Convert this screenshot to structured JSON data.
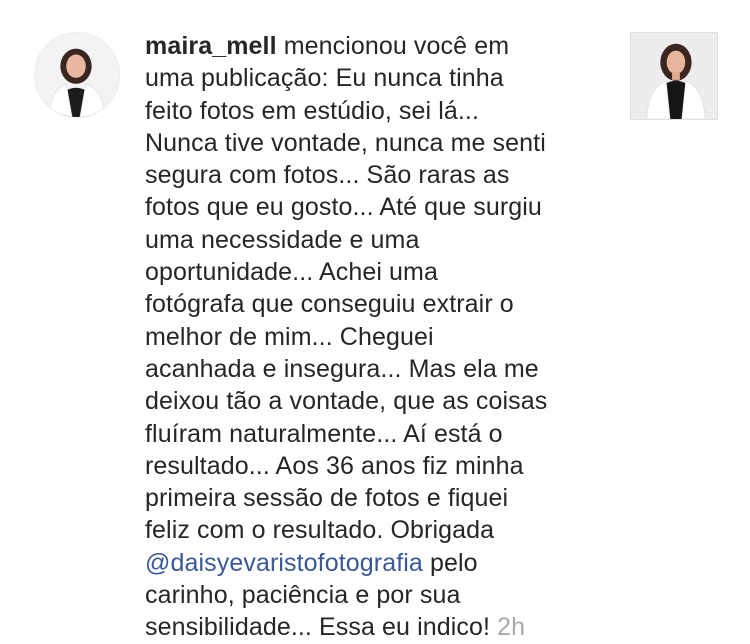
{
  "notification": {
    "username": "maira_mell",
    "lines": [
      "mencionou você em",
      "uma publicação: Eu nunca tinha",
      "feito fotos em estúdio, sei lá...",
      "Nunca tive vontade, nunca me senti",
      "segura com fotos... São raras as",
      "fotos que eu gosto... Até que surgiu",
      "uma necessidade e uma",
      "oportunidade... Achei uma",
      "fotógrafa que conseguiu extrair o",
      "melhor de mim... Cheguei",
      "acanhada e insegura... Mas ela me",
      "deixou tão a vontade, que as coisas",
      "fluíram naturalmente... Aí está o",
      "resultado... Aos 36 anos fiz minha",
      "primeira sessão de fotos e fiquei",
      "feliz com o resultado. Obrigada"
    ],
    "mention": "@daisyevaristofotografia",
    "after_mention": "pelo",
    "line_after_2": "carinho, paciência e por sua",
    "last_line": "sensibilidade... Essa eu indico!",
    "timestamp": "2h",
    "avatar_icon": "profile-avatar-photo",
    "thumbnail_icon": "post-thumbnail-photo",
    "mention_color": "#385898",
    "timestamp_color": "#a8a8a8"
  }
}
